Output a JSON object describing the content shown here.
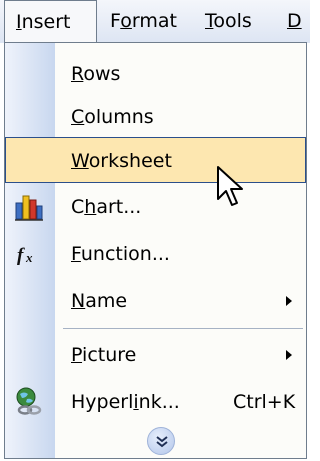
{
  "menubar": {
    "items": [
      {
        "label": "Insert",
        "mnemonic": "I"
      },
      {
        "label": "Format",
        "mnemonic": "o"
      },
      {
        "label": "Tools",
        "mnemonic": "T"
      },
      {
        "label": "D",
        "mnemonic": "D"
      }
    ]
  },
  "menu": {
    "items": [
      {
        "label": "Rows",
        "mnemonic_pre": "",
        "mnemonic": "R",
        "mnemonic_post": "ows",
        "icon": "none"
      },
      {
        "label": "Columns",
        "mnemonic_pre": "",
        "mnemonic": "C",
        "mnemonic_post": "olumns",
        "icon": "none"
      },
      {
        "label": "Worksheet",
        "mnemonic_pre": "",
        "mnemonic": "W",
        "mnemonic_post": "orksheet",
        "icon": "none",
        "highlighted": true
      },
      {
        "label": "Chart...",
        "mnemonic_pre": "C",
        "mnemonic": "h",
        "mnemonic_post": "art...",
        "icon": "chart-icon"
      },
      {
        "label": "Function...",
        "mnemonic_pre": "",
        "mnemonic": "F",
        "mnemonic_post": "unction...",
        "icon": "function-icon"
      },
      {
        "label": "Name",
        "mnemonic_pre": "",
        "mnemonic": "N",
        "mnemonic_post": "ame",
        "icon": "none",
        "submenu": true
      },
      {
        "label": "Picture",
        "mnemonic_pre": "",
        "mnemonic": "P",
        "mnemonic_post": "icture",
        "icon": "none",
        "submenu": true
      },
      {
        "label": "Hyperlink...",
        "mnemonic_pre": "Hyperl",
        "mnemonic": "i",
        "mnemonic_post": "nk...",
        "shortcut": "Ctrl+K",
        "icon": "hyperlink-icon"
      }
    ],
    "expand_icon": "chevron-double-down-icon"
  },
  "colors": {
    "highlight_fill": "#fde7b0",
    "highlight_border": "#2b4f8b",
    "gutter_start": "#eff3fb",
    "gutter_end": "#c8d7ef",
    "menu_bg": "#fcfcf9"
  }
}
